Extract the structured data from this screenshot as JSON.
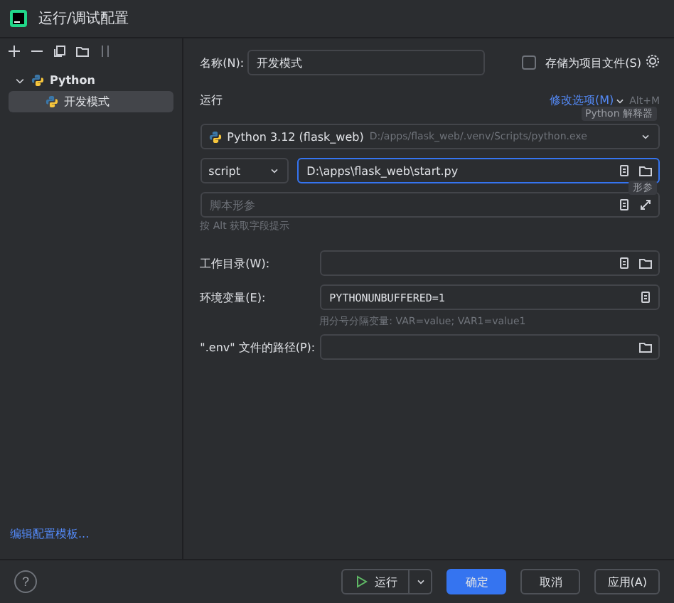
{
  "window": {
    "title": "运行/调试配置"
  },
  "tree": [
    {
      "label": "Python",
      "expanded": true,
      "selected": false,
      "children": [
        {
          "label": "开发模式",
          "selected": true
        }
      ]
    }
  ],
  "sidebar_link": "编辑配置模板...",
  "name_field": {
    "label": "名称(N):",
    "value": "开发模式"
  },
  "store_checkbox": {
    "label": "存储为项目文件(S)",
    "checked": false
  },
  "section": {
    "title": "运行",
    "modify_link": "修改选项(M)",
    "shortcut": "Alt+M",
    "tooltip": "Python 解释器"
  },
  "interpreter": {
    "name": "Python 3.12 (flask_web)",
    "path": "D:/apps/flask_web/.venv/Scripts/python.exe"
  },
  "script": {
    "mode": "script",
    "value": "D:\\apps\\flask_web\\start.py",
    "tooltip": "形参"
  },
  "params": {
    "placeholder": "脚本形参",
    "hint": "按 Alt 获取字段提示"
  },
  "fields": [
    {
      "kind": "folder",
      "label": "工作目录(W):"
    },
    {
      "kind": "env",
      "label": "环境变量(E):",
      "value": "PYTHONUNBUFFERED=1",
      "hint": "用分号分隔变量: VAR=value; VAR1=value1"
    },
    {
      "kind": "file",
      "label": "\".env\" 文件的路径(P):"
    }
  ],
  "footer": {
    "help": "?",
    "run": "运行",
    "ok": "确定",
    "cancel": "取消",
    "apply": "应用(A)"
  }
}
